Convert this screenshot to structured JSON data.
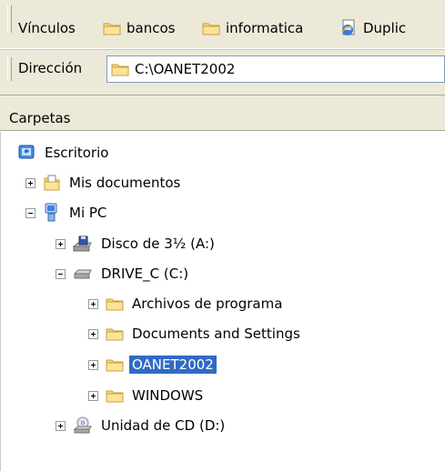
{
  "links_bar": {
    "label": "Vínculos",
    "links": [
      {
        "label": "bancos",
        "icon": "folder-icon"
      },
      {
        "label": "informatica",
        "icon": "folder-icon"
      },
      {
        "label": "Duplic",
        "icon": "ie-page-icon"
      }
    ]
  },
  "address_bar": {
    "label": "Dirección",
    "value": "C:\\OANET2002",
    "icon": "folder-icon"
  },
  "folders_pane": {
    "title": "Carpetas",
    "tree": [
      {
        "label": "Escritorio",
        "icon": "desktop-icon",
        "expander": "none"
      },
      {
        "label": "Mis documentos",
        "icon": "my-documents-icon",
        "expander": "plus"
      },
      {
        "label": "Mi PC",
        "icon": "my-computer-icon",
        "expander": "minus"
      },
      {
        "label": "Disco de 3½ (A:)",
        "icon": "floppy-drive-icon",
        "expander": "plus"
      },
      {
        "label": "DRIVE_C (C:)",
        "icon": "hard-drive-icon",
        "expander": "minus"
      },
      {
        "label": "Archivos de programa",
        "icon": "folder-icon",
        "expander": "plus"
      },
      {
        "label": "Documents and Settings",
        "icon": "folder-icon",
        "expander": "plus"
      },
      {
        "label": "OANET2002",
        "icon": "folder-icon",
        "expander": "plus",
        "selected": true
      },
      {
        "label": "WINDOWS",
        "icon": "folder-icon",
        "expander": "plus"
      },
      {
        "label": "Unidad de CD (D:)",
        "icon": "cd-drive-icon",
        "expander": "plus"
      }
    ]
  },
  "colors": {
    "toolbar_bg": "#ECE9D8",
    "selection_bg": "#316AC5",
    "address_border": "#7F9DB9"
  }
}
